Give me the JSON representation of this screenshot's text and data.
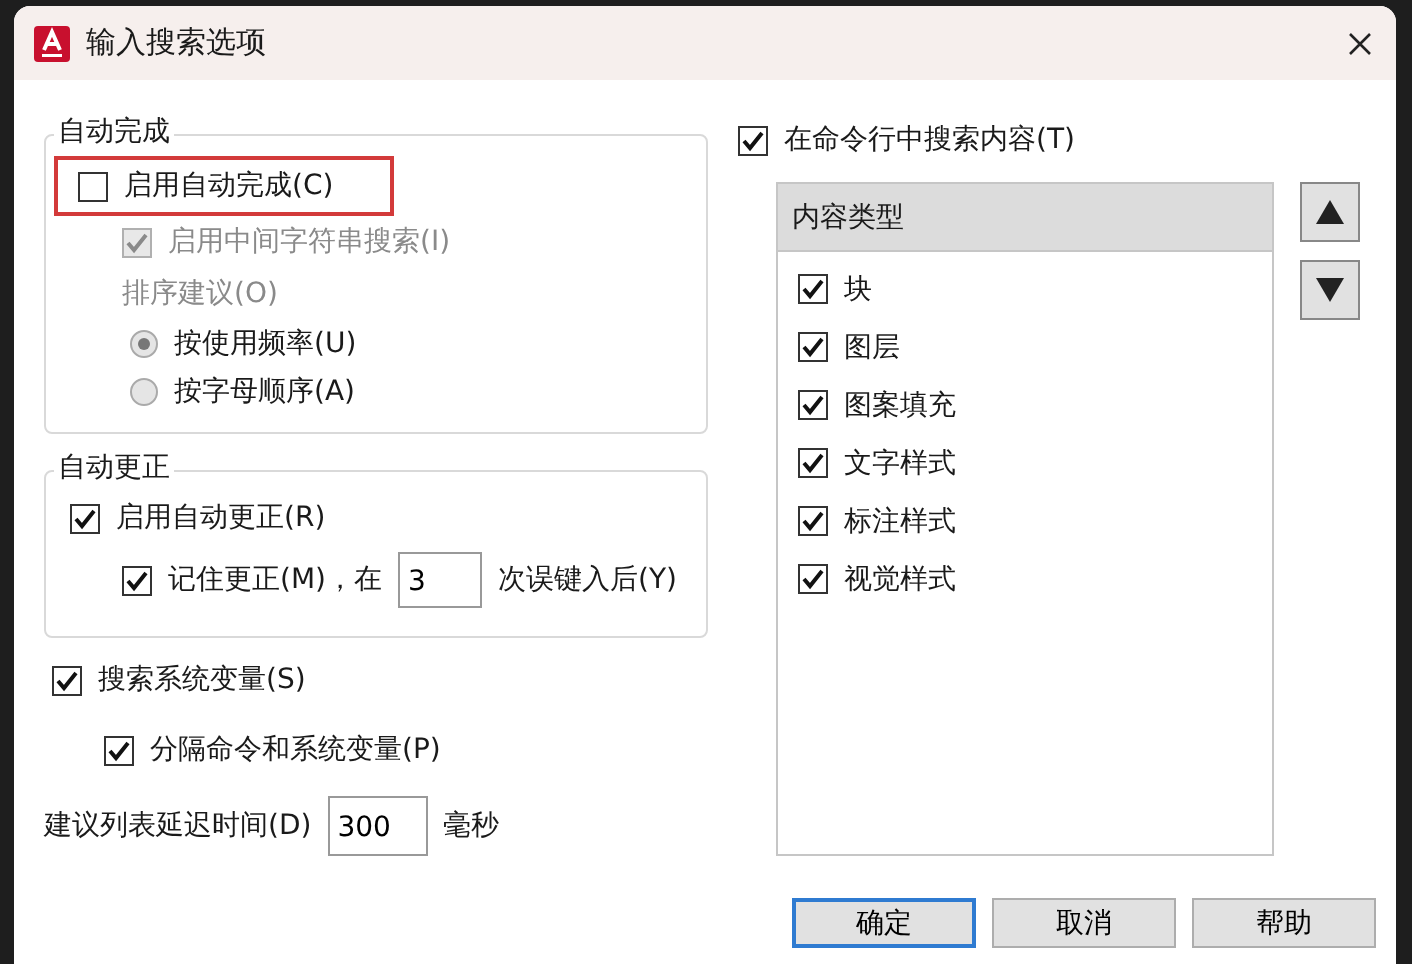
{
  "window": {
    "title": "输入搜索选项"
  },
  "autocomplete": {
    "title": "自动完成",
    "enable": {
      "label": "启用自动完成(C)",
      "checked": false,
      "highlighted": true
    },
    "mid_string": {
      "label": "启用中间字符串搜索(I)",
      "checked": true,
      "disabled": true
    },
    "sort_label": {
      "text": "排序建议(O)",
      "disabled": true
    },
    "sort_options": [
      {
        "label": "按使用频率(U)",
        "selected": true,
        "disabled": true
      },
      {
        "label": "按字母顺序(A)",
        "selected": false,
        "disabled": true
      }
    ]
  },
  "autocorrect": {
    "title": "自动更正",
    "enable": {
      "label": "启用自动更正(R)",
      "checked": true
    },
    "remember": {
      "label": "记住更正(M)，在",
      "checked": true,
      "value": "3",
      "suffix": "次误键入后(Y)"
    }
  },
  "search_system_variables": {
    "label": "搜索系统变量(S)",
    "checked": true
  },
  "separate": {
    "label": "分隔命令和系统变量(P)",
    "checked": true
  },
  "delay": {
    "label": "建议列表延迟时间(D)",
    "value": "300",
    "unit": "毫秒"
  },
  "search_content": {
    "label": "在命令行中搜索内容(T)",
    "checked": true
  },
  "content_types": {
    "header": "内容类型",
    "items": [
      {
        "label": "块",
        "checked": true
      },
      {
        "label": "图层",
        "checked": true
      },
      {
        "label": "图案填充",
        "checked": true
      },
      {
        "label": "文字样式",
        "checked": true
      },
      {
        "label": "标注样式",
        "checked": true
      },
      {
        "label": "视觉样式",
        "checked": true
      }
    ]
  },
  "buttons": [
    {
      "label": "确定",
      "default": true
    },
    {
      "label": "取消",
      "default": false
    },
    {
      "label": "帮助",
      "default": false
    }
  ]
}
